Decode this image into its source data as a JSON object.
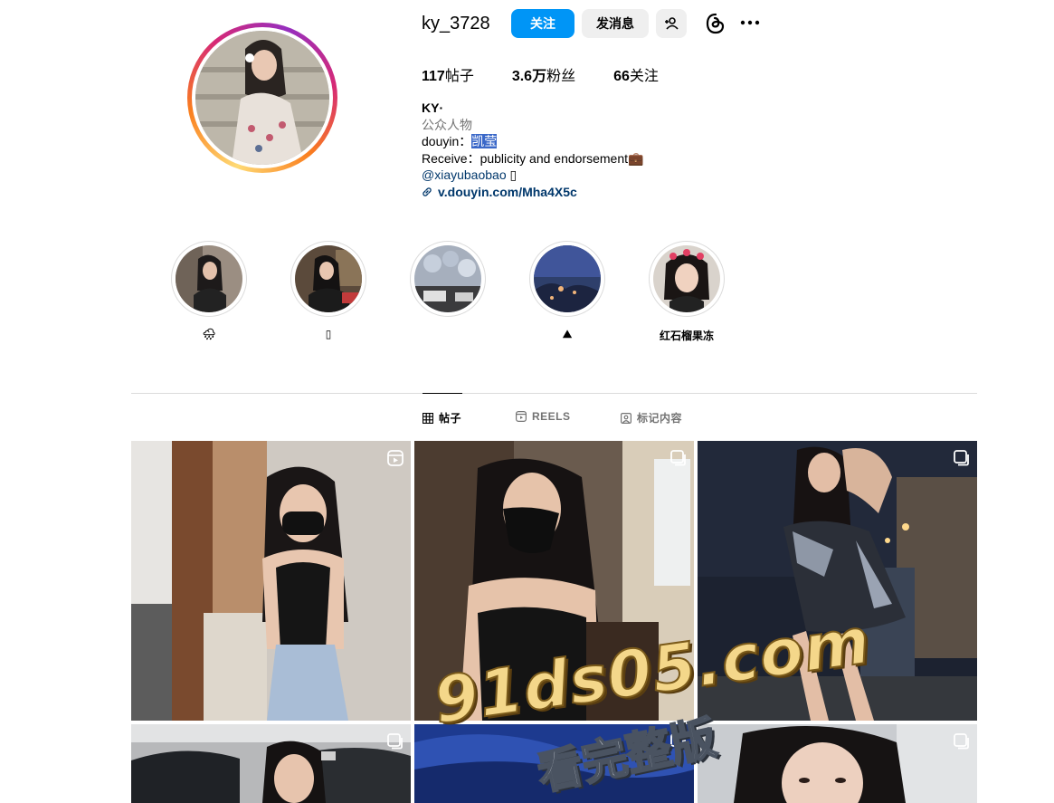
{
  "profile": {
    "username": "ky_3728",
    "follow_label": "关注",
    "message_label": "发消息",
    "stats": {
      "posts_count": "117",
      "posts_label": "帖子",
      "followers_count": "3.6万",
      "followers_label": "粉丝",
      "following_count": "66",
      "following_label": "关注"
    },
    "bio": {
      "name": "KY·",
      "category": "公众人物",
      "line1_prefix": "douyin：",
      "line1_highlight": "凯莹",
      "line2": "Receive：publicity and endorsement💼",
      "mention": "@xiayubaobao",
      "mention_suffix": " ▯",
      "link": "v.douyin.com/Mha4X5c"
    }
  },
  "highlights": [
    {
      "label": "🌧"
    },
    {
      "label": "▯"
    },
    {
      "label": ""
    },
    {
      "label": "⛰"
    },
    {
      "label": "红石榴果冻"
    }
  ],
  "tabs": {
    "posts": "帖子",
    "reels": "REELS",
    "tagged": "标记内容"
  },
  "watermark": {
    "main": "91ds05.com",
    "sub": "看完整版"
  },
  "colors": {
    "accent": "#0095f6",
    "link": "#00376b",
    "divider": "#dbdbdb"
  }
}
